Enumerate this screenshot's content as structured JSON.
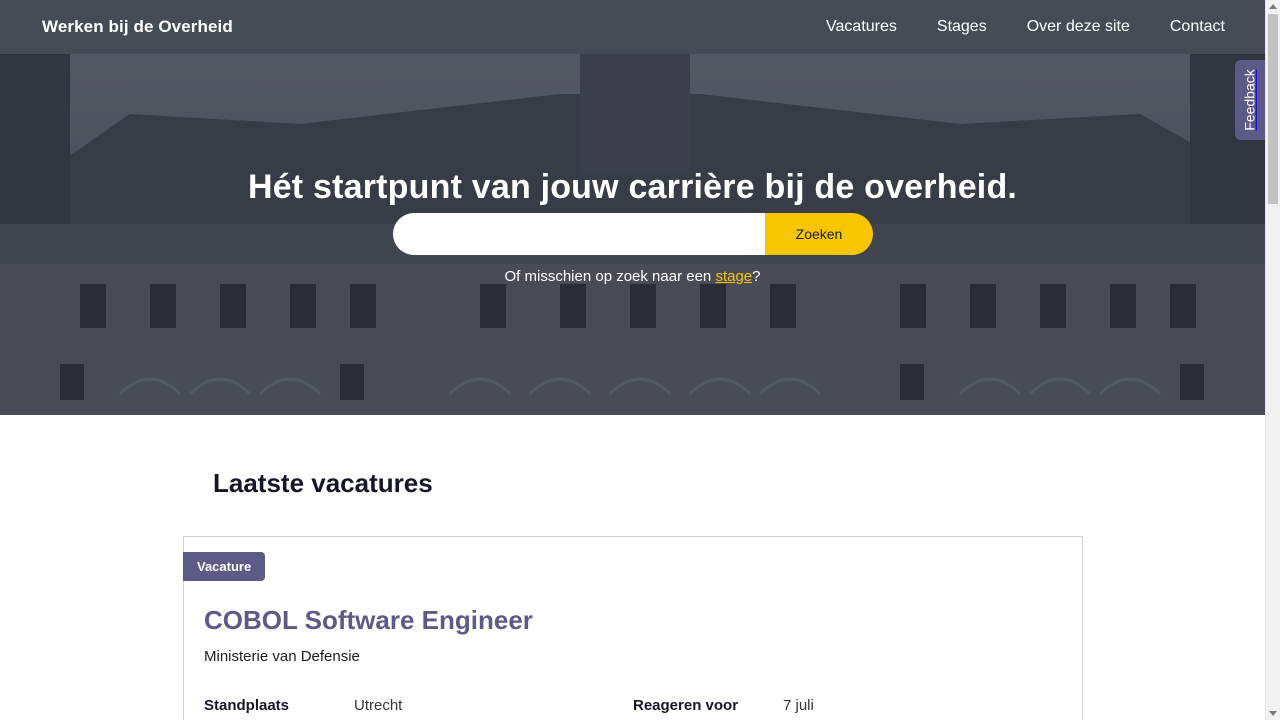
{
  "nav": {
    "brand": "Werken bij de Overheid",
    "items": [
      "Vacatures",
      "Stages",
      "Over deze site",
      "Contact"
    ]
  },
  "hero": {
    "title": "Hét startpunt van jouw carrière bij de overheid.",
    "search_placeholder": "",
    "search_button": "Zoeken",
    "sub_prefix": "Of misschien op zoek naar een ",
    "sub_link": "stage",
    "sub_suffix": "?"
  },
  "feedback": {
    "label": "Feedback"
  },
  "section": {
    "title": "Laatste vacatures"
  },
  "job": {
    "badge": "Vacature",
    "title": "COBOL Software Engineer",
    "org": "Ministerie van Defensie",
    "location_label": "Standplaats",
    "location": "Utrecht",
    "deadline_label": "Reageren voor",
    "deadline": "7 juli"
  },
  "colors": {
    "nav_bg": "#454c56",
    "accent": "#5d5a88",
    "button": "#f7c600"
  }
}
